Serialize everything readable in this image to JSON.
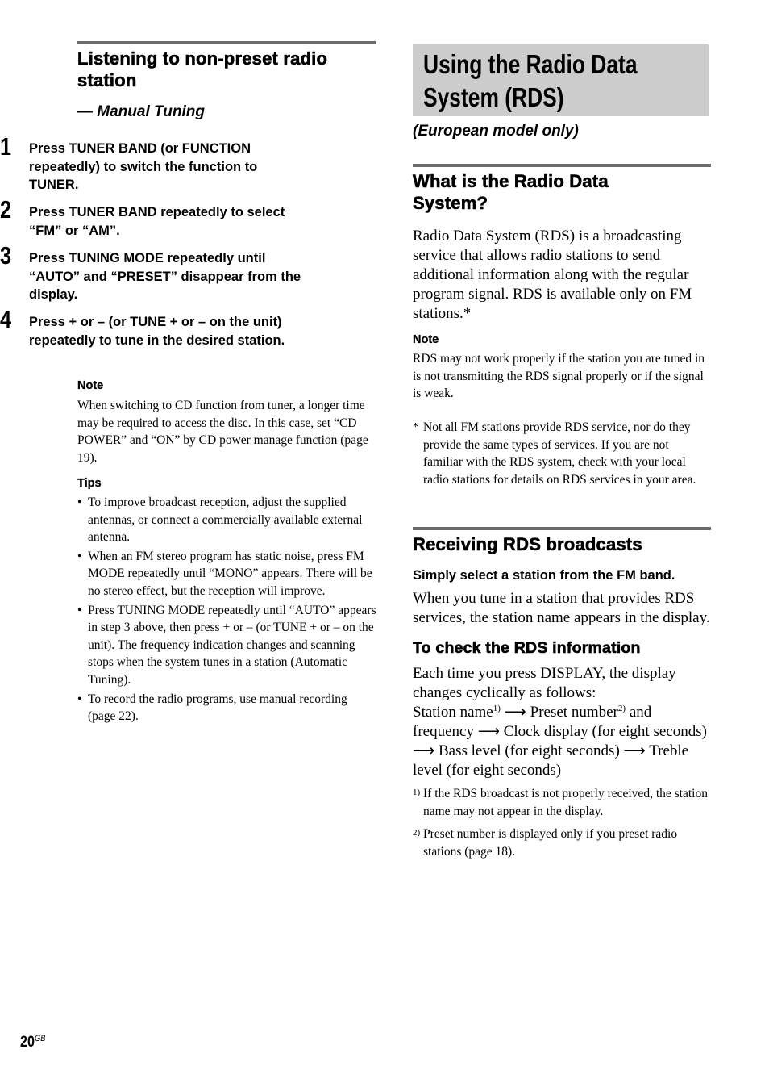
{
  "left": {
    "heading": "Listening to non-preset radio station",
    "subtitle": "— Manual Tuning",
    "steps": [
      {
        "num": "1",
        "text": "Press TUNER BAND (or FUNCTION repeatedly) to switch the function to TUNER."
      },
      {
        "num": "2",
        "text": "Press TUNER BAND repeatedly to select “FM” or “AM”."
      },
      {
        "num": "3",
        "text": "Press TUNING MODE repeatedly until “AUTO” and “PRESET” disappear from the display."
      },
      {
        "num": "4",
        "text": "Press + or – (or TUNE + or – on the unit) repeatedly to tune in the desired station."
      }
    ],
    "note_label": "Note",
    "note_text": "When switching to CD function from tuner, a longer time may be required to access the disc. In this case, set “CD POWER” and “ON” by CD power manage function (page 19).",
    "tips_label": "Tips",
    "bullet_char": "•",
    "tips": [
      "To improve broadcast reception, adjust the supplied antennas, or connect a commercially available external antenna.",
      "When an FM stereo program has static noise, press FM MODE repeatedly until “MONO” appears. There will be no stereo effect, but the reception will improve.",
      "Press TUNING MODE repeatedly until “AUTO” appears in step 3 above, then press + or – (or TUNE + or – on the unit). The frequency indication changes and scanning stops when the system tunes in a station (Automatic Tuning).",
      "To record the radio programs, use manual recording (page 22)."
    ]
  },
  "right": {
    "title_line1": "Using the Radio Data",
    "title_line2": "System (RDS)",
    "subtitle": "(European model only)",
    "what_heading": "What is the Radio Data System?",
    "what_body": "Radio Data System (RDS) is a broadcasting service that allows radio stations to send additional information along with the regular program signal. RDS is available only on FM stations.*",
    "note_label": "Note",
    "note_text": "RDS may not work properly if the station you are tuned in is not transmitting the RDS signal properly or if the signal is weak.",
    "asterisk_mark": "*",
    "asterisk_text": "Not all FM stations provide RDS service, nor do they provide the same types of services. If you are not familiar with the RDS system, check with your local radio stations for details on RDS services in your area.",
    "receiving_heading": "Receiving RDS broadcasts",
    "receiving_lead": "Simply select a station from the FM band.",
    "receiving_body": "When you tune in a station that provides RDS services, the station name appears in the display.",
    "check_heading": "To check the RDS information",
    "check_intro": "Each time you press DISPLAY, the display changes cyclically as follows:",
    "cycle": {
      "station_name": "Station name",
      "sup1": "1)",
      "arrow": "⟶",
      "preset": "Preset number",
      "sup2": "2)",
      "and_freq": "and frequency",
      "clock": "Clock display (for eight seconds)",
      "bass": "Bass level (for eight seconds)",
      "treble": "Treble level (for eight seconds)"
    },
    "footnotes": [
      {
        "mark": "1)",
        "text": "If the RDS broadcast is not properly received, the station name may not appear in the display."
      },
      {
        "mark": "2)",
        "text": "Preset number is displayed only if you preset radio stations (page 18)."
      }
    ]
  },
  "page": {
    "number": "20",
    "suffix": "GB"
  }
}
